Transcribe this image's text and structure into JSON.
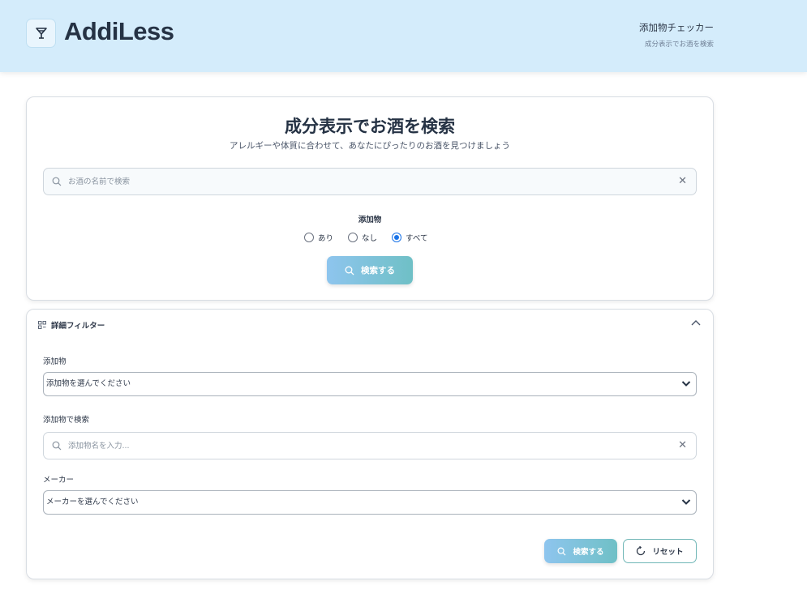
{
  "header": {
    "brand": "AddiLess",
    "title": "添加物チェッカー",
    "subtitle": "成分表示でお酒を検索"
  },
  "main": {
    "title": "成分表示でお酒を検索",
    "subtitle": "アレルギーや体質に合わせて、あなたにぴったりのお酒を見つけましょう",
    "search_placeholder": "お酒の名前で検索",
    "additive_label": "添加物",
    "radio_options": [
      "あり",
      "なし",
      "すべて"
    ],
    "radio_selected": "すべて",
    "search_button": "検索する"
  },
  "filter": {
    "title": "詳細フィルター",
    "additive_label": "添加物",
    "additive_select": "添加物を選んでください",
    "additive_search_label": "添加物で検索",
    "additive_search_placeholder": "添加物名を入力...",
    "maker_label": "メーカー",
    "maker_select": "メーカーを選んでください",
    "search_button": "検索する",
    "reset_button": "リセット"
  },
  "colors": {
    "header_bg": "#d4ecfb",
    "button_gradient_start": "#8ec5ee",
    "button_gradient_end": "#6fc0c6",
    "radio_checked": "#1a73e8"
  },
  "icons": {
    "logo": "cocktail-glass-icon",
    "search": "search-icon",
    "clear": "close-icon",
    "filter": "filter-grid-icon",
    "collapse": "chevron-up-icon",
    "select": "chevron-down-icon",
    "reset": "refresh-icon"
  }
}
